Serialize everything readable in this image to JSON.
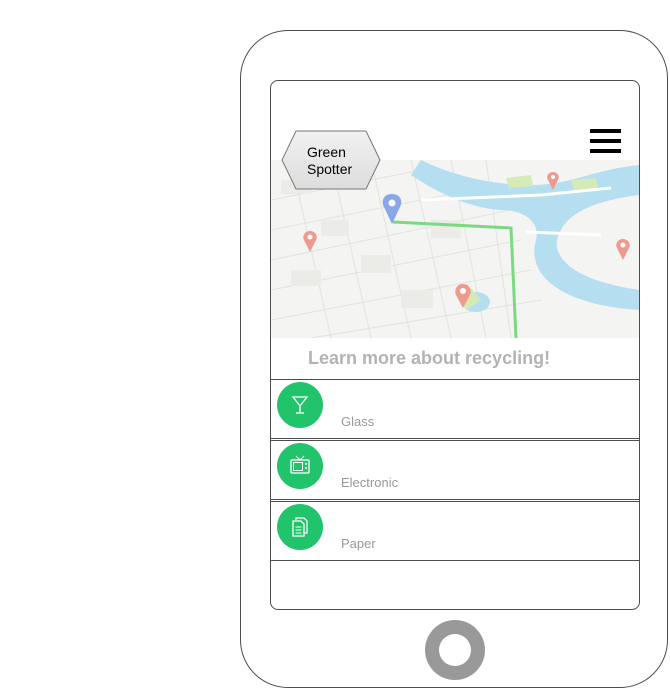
{
  "app": {
    "logo_line1": "Green",
    "logo_line2": "Spotter"
  },
  "main": {
    "subtitle": "Learn more about recycling!"
  },
  "categories": [
    {
      "label": "Glass",
      "icon": "cocktail-glass-icon"
    },
    {
      "label": "Electronic",
      "icon": "tv-icon"
    },
    {
      "label": "Paper",
      "icon": "document-icon"
    }
  ],
  "colors": {
    "accent": "#21c46a",
    "subtitle": "#b3b3b3",
    "label": "#999999"
  }
}
